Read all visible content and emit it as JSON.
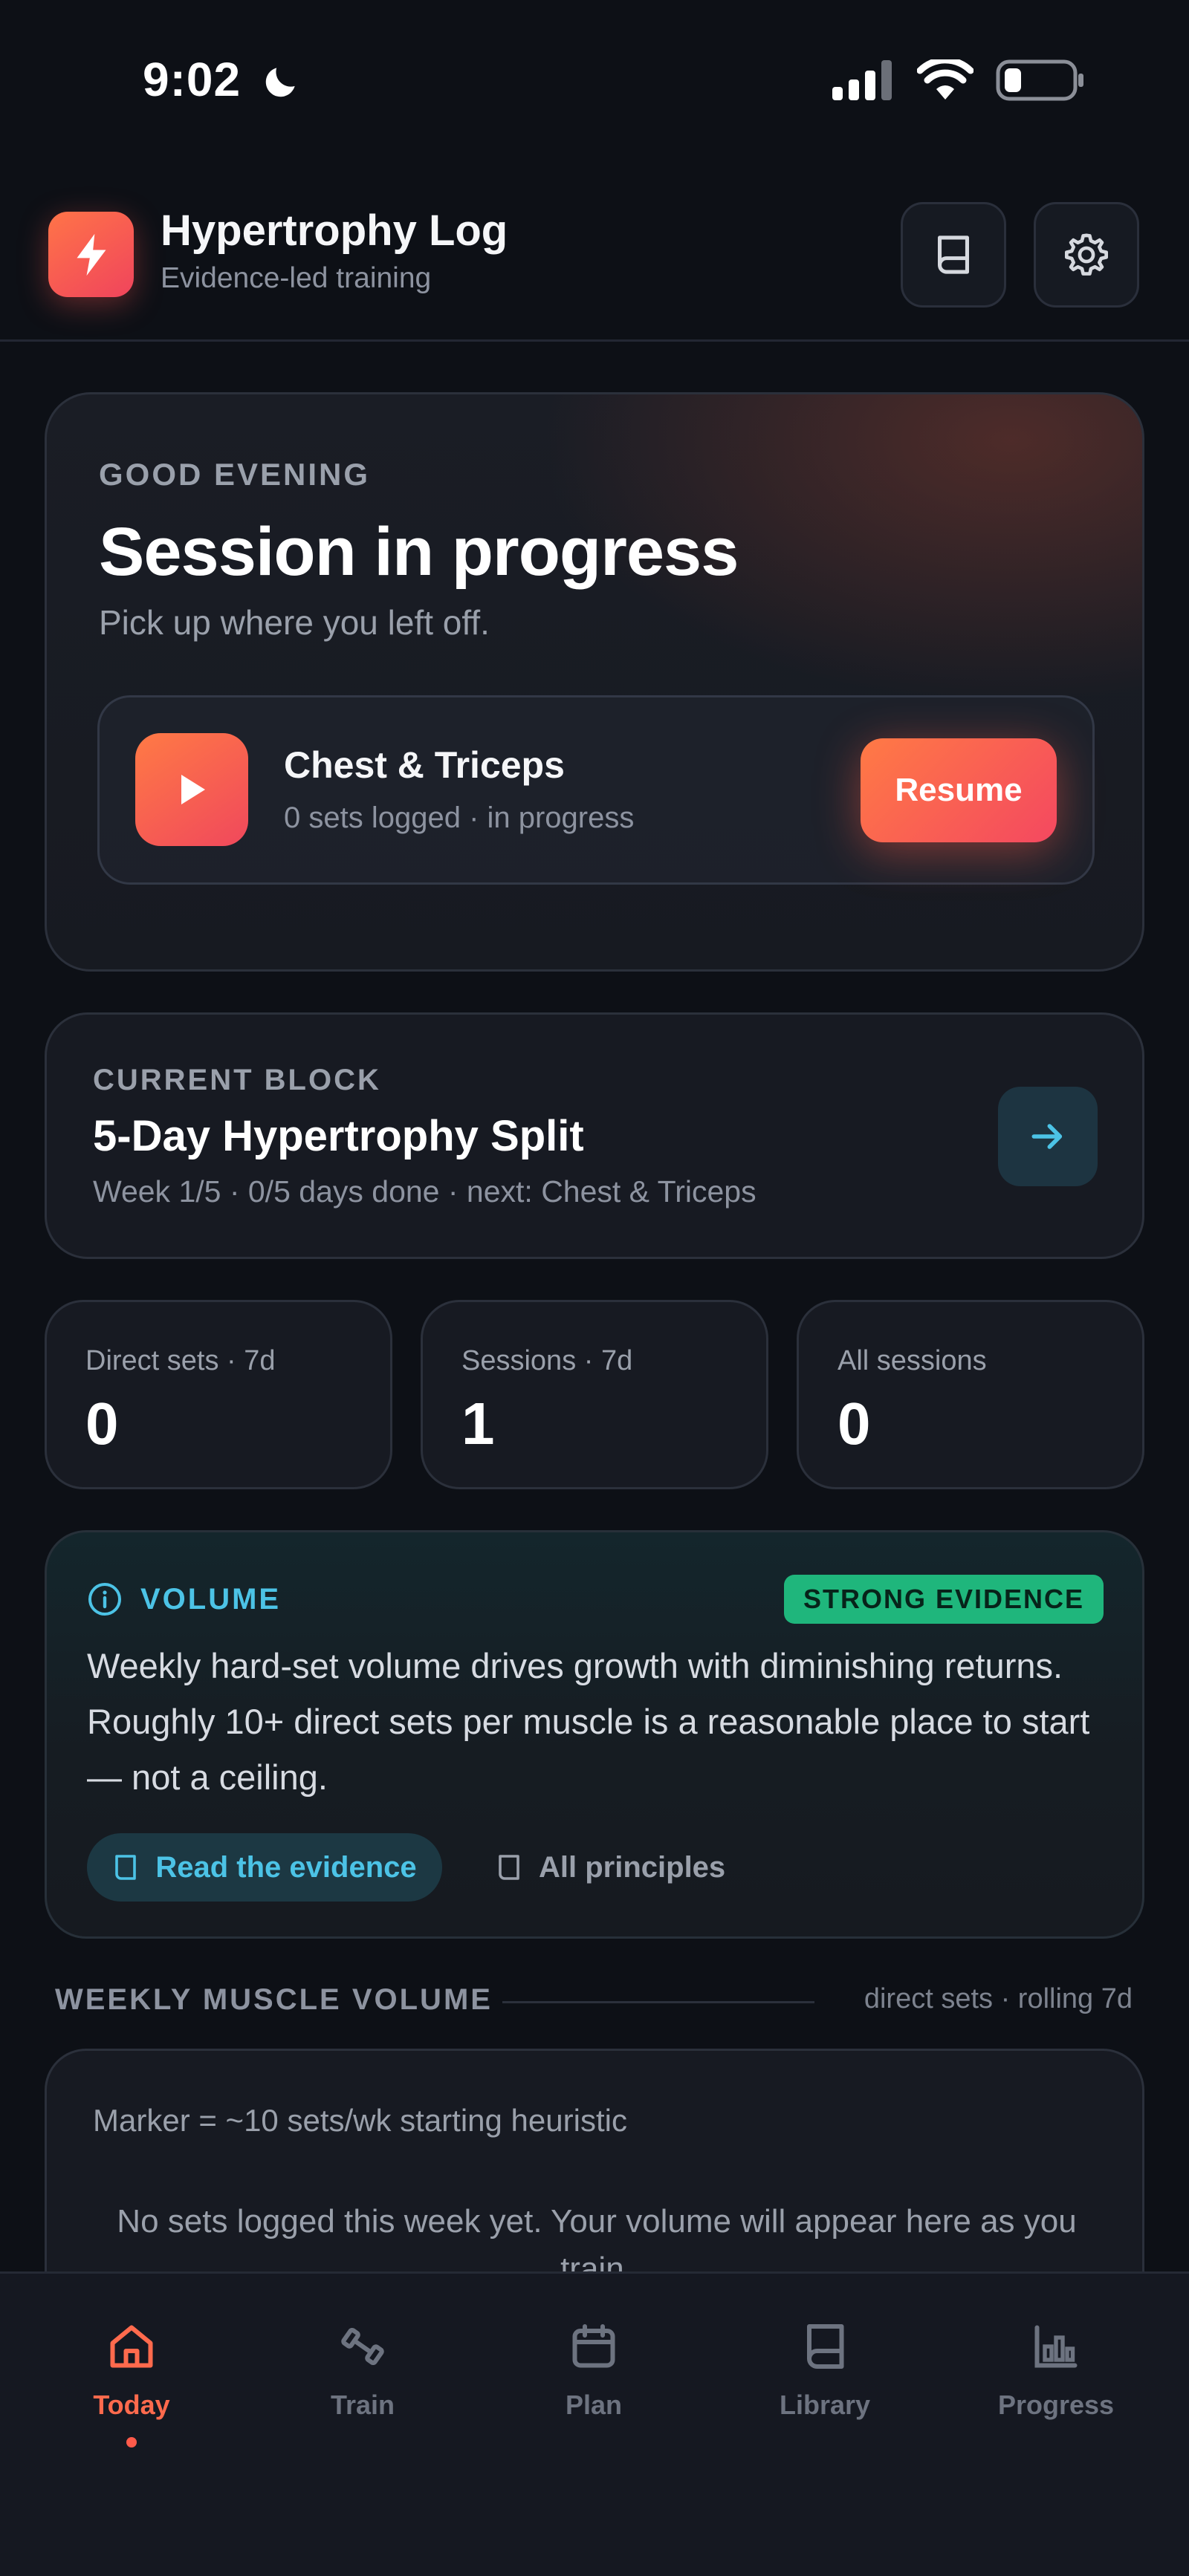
{
  "status_bar": {
    "time": "9:02"
  },
  "header": {
    "title": "Hypertrophy Log",
    "subtitle": "Evidence-led training"
  },
  "hero": {
    "greeting": "GOOD EVENING",
    "title": "Session in progress",
    "subtitle": "Pick up where you left off.",
    "session": {
      "name": "Chest & Triceps",
      "meta": "0 sets logged · in progress",
      "resume_label": "Resume"
    }
  },
  "current_block": {
    "label": "CURRENT BLOCK",
    "title": "5-Day Hypertrophy Split",
    "meta": "Week 1/5 · 0/5 days done · next: Chest & Triceps"
  },
  "stats": [
    {
      "label": "Direct sets · 7d",
      "value": "0"
    },
    {
      "label": "Sessions · 7d",
      "value": "1"
    },
    {
      "label": "All sessions",
      "value": "0"
    }
  ],
  "evidence": {
    "label": "VOLUME",
    "badge": "STRONG EVIDENCE",
    "text": "Weekly hard-set volume drives growth with diminishing returns. Roughly 10+ direct sets per muscle is a reasonable place to start — not a ceiling.",
    "read_label": "Read the evidence",
    "all_label": "All principles"
  },
  "weekly_volume": {
    "title": "WEEKLY MUSCLE VOLUME",
    "note": "direct sets · rolling 7d",
    "marker": "Marker = ~10 sets/wk starting heuristic",
    "empty": "No sets logged this week yet. Your volume will appear here as you train."
  },
  "nav": {
    "items": [
      {
        "label": "Today",
        "active": true
      },
      {
        "label": "Train"
      },
      {
        "label": "Plan"
      },
      {
        "label": "Library"
      },
      {
        "label": "Progress"
      }
    ]
  },
  "colors": {
    "accent": "#ff6a4d",
    "info": "#4cc3e6",
    "success": "#1fb67c",
    "background": "#0d1016",
    "card": "#171a22"
  },
  "icons": {
    "logo": "lightning-bolt-icon",
    "header_actions": [
      "book-icon",
      "gear-icon"
    ],
    "session": "play-icon",
    "block_action": "arrow-right-icon",
    "evidence": "info-icon",
    "nav": [
      "home-icon",
      "dumbbell-icon",
      "calendar-icon",
      "book-icon",
      "bar-chart-icon"
    ]
  }
}
